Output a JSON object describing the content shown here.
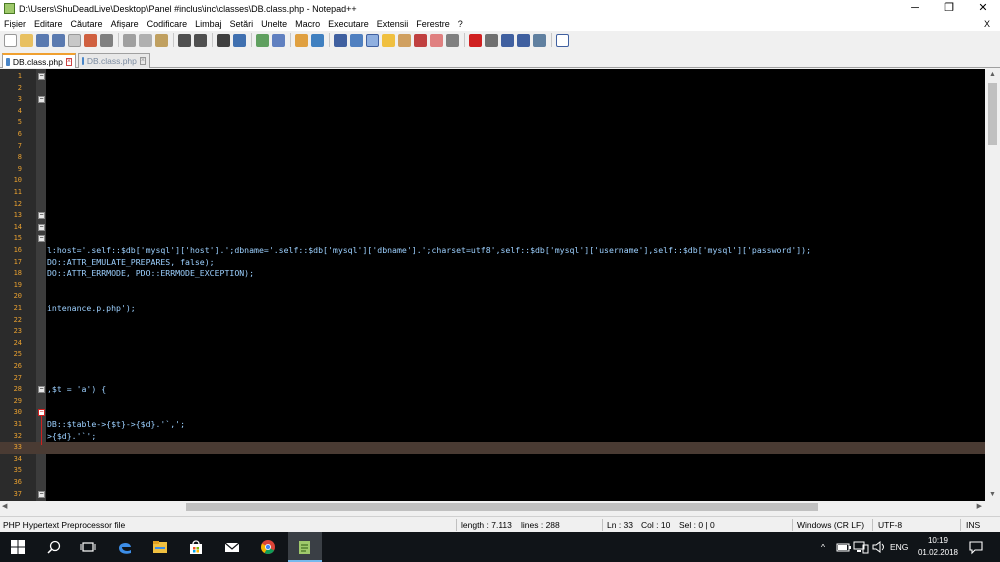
{
  "window": {
    "title": "D:\\Users\\ShuDeadLive\\Desktop\\Panel #inclus\\inc\\classes\\DB.class.php - Notepad++",
    "minimize": "─",
    "restore": "❐",
    "close": "✕"
  },
  "menu": {
    "items": [
      "Fișier",
      "Editare",
      "Căutare",
      "Afișare",
      "Codificare",
      "Limbaj",
      "Setări",
      "Unelte",
      "Macro",
      "Executare",
      "Extensii",
      "Ferestre",
      "?"
    ],
    "close_doc": "X"
  },
  "tabs": [
    {
      "label": "DB.class.php",
      "active": true
    },
    {
      "label": "DB.class.php",
      "active": false
    }
  ],
  "editor": {
    "lines": [
      {
        "n": "1",
        "code": "",
        "fold": "minus"
      },
      {
        "n": "2",
        "code": ""
      },
      {
        "n": "3",
        "code": "",
        "fold": "minus"
      },
      {
        "n": "4",
        "code": ""
      },
      {
        "n": "5",
        "code": ""
      },
      {
        "n": "6",
        "code": ""
      },
      {
        "n": "7",
        "code": ""
      },
      {
        "n": "8",
        "code": ""
      },
      {
        "n": "9",
        "code": ""
      },
      {
        "n": "10",
        "code": ""
      },
      {
        "n": "11",
        "code": ""
      },
      {
        "n": "12",
        "code": ""
      },
      {
        "n": "13",
        "code": "",
        "fold": "minus"
      },
      {
        "n": "14",
        "code": "",
        "fold": "minus"
      },
      {
        "n": "15",
        "code": "",
        "fold": "minus"
      },
      {
        "n": "16",
        "code": "l:host='.self::$db['mysql']['host'].';dbname='.self::$db['mysql']['dbname'].';charset=utf8',self::$db['mysql']['username'],self::$db['mysql']['password']);"
      },
      {
        "n": "17",
        "code": "DO::ATTR_EMULATE_PREPARES, false);"
      },
      {
        "n": "18",
        "code": "DO::ATTR_ERRMODE, PDO::ERRMODE_EXCEPTION);"
      },
      {
        "n": "19",
        "code": ""
      },
      {
        "n": "20",
        "code": ""
      },
      {
        "n": "21",
        "code": "intenance.p.php');"
      },
      {
        "n": "22",
        "code": ""
      },
      {
        "n": "23",
        "code": ""
      },
      {
        "n": "24",
        "code": ""
      },
      {
        "n": "25",
        "code": ""
      },
      {
        "n": "26",
        "code": ""
      },
      {
        "n": "27",
        "code": ""
      },
      {
        "n": "28",
        "code": ",$t = 'a') {",
        "fold": "minus"
      },
      {
        "n": "29",
        "code": ""
      },
      {
        "n": "30",
        "code": "",
        "fold": "red"
      },
      {
        "n": "31",
        "code": "DB::$table->{$t}->{$d}.'`,';"
      },
      {
        "n": "32",
        "code": ">{$d}.'`';"
      },
      {
        "n": "33",
        "code": "",
        "current": true
      },
      {
        "n": "34",
        "code": ""
      },
      {
        "n": "35",
        "code": ""
      },
      {
        "n": "36",
        "code": ""
      },
      {
        "n": "37",
        "code": "",
        "fold": "minus"
      }
    ]
  },
  "scroll": {
    "up": "▲",
    "down": "▼",
    "left": "◀",
    "right": "▶"
  },
  "status": {
    "filetype": "PHP Hypertext Preprocessor file",
    "length": "length : 7.113",
    "lines": "lines : 288",
    "ln": "Ln : 33",
    "col": "Col : 10",
    "sel": "Sel : 0 | 0",
    "eol": "Windows (CR LF)",
    "encoding": "UTF-8",
    "mode": "INS"
  },
  "taskbar": {
    "lang": "ENG",
    "time": "10:19",
    "date": "01.02.2018",
    "tray_chevron": "^"
  },
  "colors": {
    "editor_bg": "#000000",
    "code_text": "#9cd0ff",
    "line_numbers": "#e8a030",
    "current_line": "#4a3b33"
  }
}
